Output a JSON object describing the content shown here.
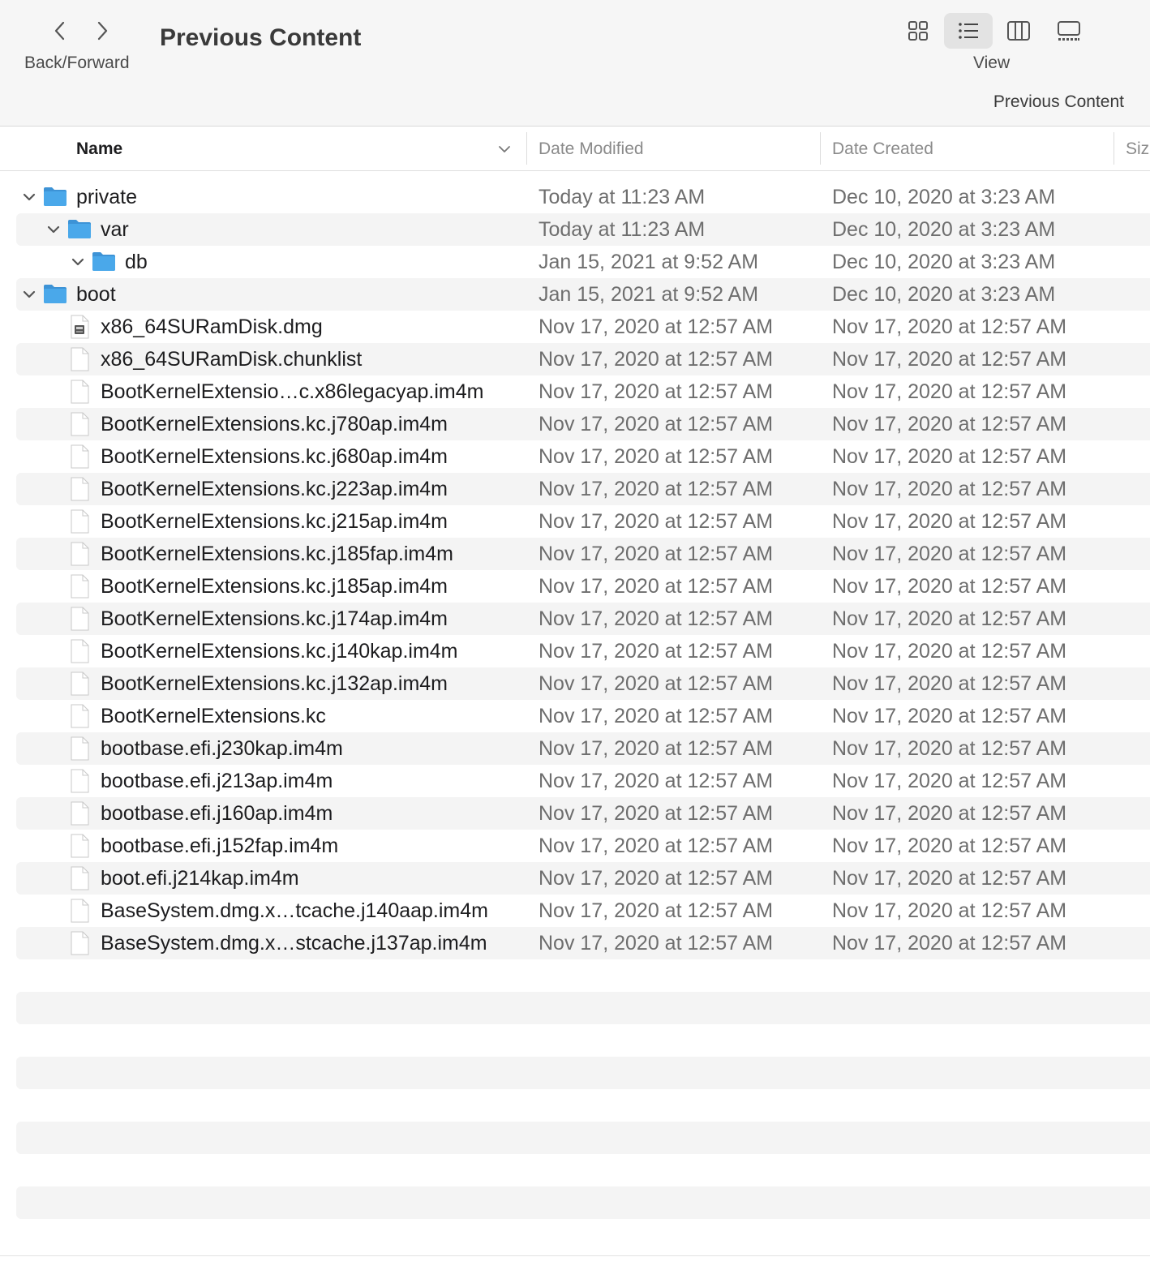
{
  "toolbar": {
    "nav_label": "Back/Forward",
    "title": "Previous Content",
    "view_label": "View",
    "path_label": "Previous Content"
  },
  "columns": {
    "name": "Name",
    "date_modified": "Date Modified",
    "date_created": "Date Created",
    "size": "Siz"
  },
  "rows": [
    {
      "name": "private",
      "depth": 0,
      "kind": "folder",
      "expanded": true,
      "modified": "Today at 11:23 AM",
      "created": "Dec 10, 2020 at 3:23 AM"
    },
    {
      "name": "var",
      "depth": 1,
      "kind": "folder",
      "expanded": true,
      "modified": "Today at 11:23 AM",
      "created": "Dec 10, 2020 at 3:23 AM"
    },
    {
      "name": "db",
      "depth": 2,
      "kind": "folder",
      "expanded": true,
      "modified": "Jan 15, 2021 at 9:52 AM",
      "created": "Dec 10, 2020 at 3:23 AM"
    },
    {
      "name": "boot",
      "depth": 0,
      "kind": "folder",
      "expanded": true,
      "modified": "Jan 15, 2021 at 9:52 AM",
      "created": "Dec 10, 2020 at 3:23 AM"
    },
    {
      "name": "x86_64SURamDisk.dmg",
      "depth": 1,
      "kind": "dmg",
      "modified": "Nov 17, 2020 at 12:57 AM",
      "created": "Nov 17, 2020 at 12:57 AM"
    },
    {
      "name": "x86_64SURamDisk.chunklist",
      "depth": 1,
      "kind": "file",
      "modified": "Nov 17, 2020 at 12:57 AM",
      "created": "Nov 17, 2020 at 12:57 AM"
    },
    {
      "name": "BootKernelExtensio…c.x86legacyap.im4m",
      "depth": 1,
      "kind": "file",
      "modified": "Nov 17, 2020 at 12:57 AM",
      "created": "Nov 17, 2020 at 12:57 AM"
    },
    {
      "name": "BootKernelExtensions.kc.j780ap.im4m",
      "depth": 1,
      "kind": "file",
      "modified": "Nov 17, 2020 at 12:57 AM",
      "created": "Nov 17, 2020 at 12:57 AM"
    },
    {
      "name": "BootKernelExtensions.kc.j680ap.im4m",
      "depth": 1,
      "kind": "file",
      "modified": "Nov 17, 2020 at 12:57 AM",
      "created": "Nov 17, 2020 at 12:57 AM"
    },
    {
      "name": "BootKernelExtensions.kc.j223ap.im4m",
      "depth": 1,
      "kind": "file",
      "modified": "Nov 17, 2020 at 12:57 AM",
      "created": "Nov 17, 2020 at 12:57 AM"
    },
    {
      "name": "BootKernelExtensions.kc.j215ap.im4m",
      "depth": 1,
      "kind": "file",
      "modified": "Nov 17, 2020 at 12:57 AM",
      "created": "Nov 17, 2020 at 12:57 AM"
    },
    {
      "name": "BootKernelExtensions.kc.j185fap.im4m",
      "depth": 1,
      "kind": "file",
      "modified": "Nov 17, 2020 at 12:57 AM",
      "created": "Nov 17, 2020 at 12:57 AM"
    },
    {
      "name": "BootKernelExtensions.kc.j185ap.im4m",
      "depth": 1,
      "kind": "file",
      "modified": "Nov 17, 2020 at 12:57 AM",
      "created": "Nov 17, 2020 at 12:57 AM"
    },
    {
      "name": "BootKernelExtensions.kc.j174ap.im4m",
      "depth": 1,
      "kind": "file",
      "modified": "Nov 17, 2020 at 12:57 AM",
      "created": "Nov 17, 2020 at 12:57 AM"
    },
    {
      "name": "BootKernelExtensions.kc.j140kap.im4m",
      "depth": 1,
      "kind": "file",
      "modified": "Nov 17, 2020 at 12:57 AM",
      "created": "Nov 17, 2020 at 12:57 AM"
    },
    {
      "name": "BootKernelExtensions.kc.j132ap.im4m",
      "depth": 1,
      "kind": "file",
      "modified": "Nov 17, 2020 at 12:57 AM",
      "created": "Nov 17, 2020 at 12:57 AM"
    },
    {
      "name": "BootKernelExtensions.kc",
      "depth": 1,
      "kind": "file",
      "modified": "Nov 17, 2020 at 12:57 AM",
      "created": "Nov 17, 2020 at 12:57 AM"
    },
    {
      "name": "bootbase.efi.j230kap.im4m",
      "depth": 1,
      "kind": "file",
      "modified": "Nov 17, 2020 at 12:57 AM",
      "created": "Nov 17, 2020 at 12:57 AM"
    },
    {
      "name": "bootbase.efi.j213ap.im4m",
      "depth": 1,
      "kind": "file",
      "modified": "Nov 17, 2020 at 12:57 AM",
      "created": "Nov 17, 2020 at 12:57 AM"
    },
    {
      "name": "bootbase.efi.j160ap.im4m",
      "depth": 1,
      "kind": "file",
      "modified": "Nov 17, 2020 at 12:57 AM",
      "created": "Nov 17, 2020 at 12:57 AM"
    },
    {
      "name": "bootbase.efi.j152fap.im4m",
      "depth": 1,
      "kind": "file",
      "modified": "Nov 17, 2020 at 12:57 AM",
      "created": "Nov 17, 2020 at 12:57 AM"
    },
    {
      "name": "boot.efi.j214kap.im4m",
      "depth": 1,
      "kind": "file",
      "modified": "Nov 17, 2020 at 12:57 AM",
      "created": "Nov 17, 2020 at 12:57 AM"
    },
    {
      "name": "BaseSystem.dmg.x…tcache.j140aap.im4m",
      "depth": 1,
      "kind": "file",
      "modified": "Nov 17, 2020 at 12:57 AM",
      "created": "Nov 17, 2020 at 12:57 AM"
    },
    {
      "name": "BaseSystem.dmg.x…stcache.j137ap.im4m",
      "depth": 1,
      "kind": "file",
      "modified": "Nov 17, 2020 at 12:57 AM",
      "created": "Nov 17, 2020 at 12:57 AM"
    }
  ],
  "icons": {
    "folder": "folder-icon",
    "file": "document-icon",
    "dmg": "disk-image-icon",
    "disclosure": "chevron-down-icon"
  },
  "colors": {
    "folder": "#4aa8ea",
    "stripe": "#f4f4f4",
    "toolbar": "#f6f6f6"
  }
}
